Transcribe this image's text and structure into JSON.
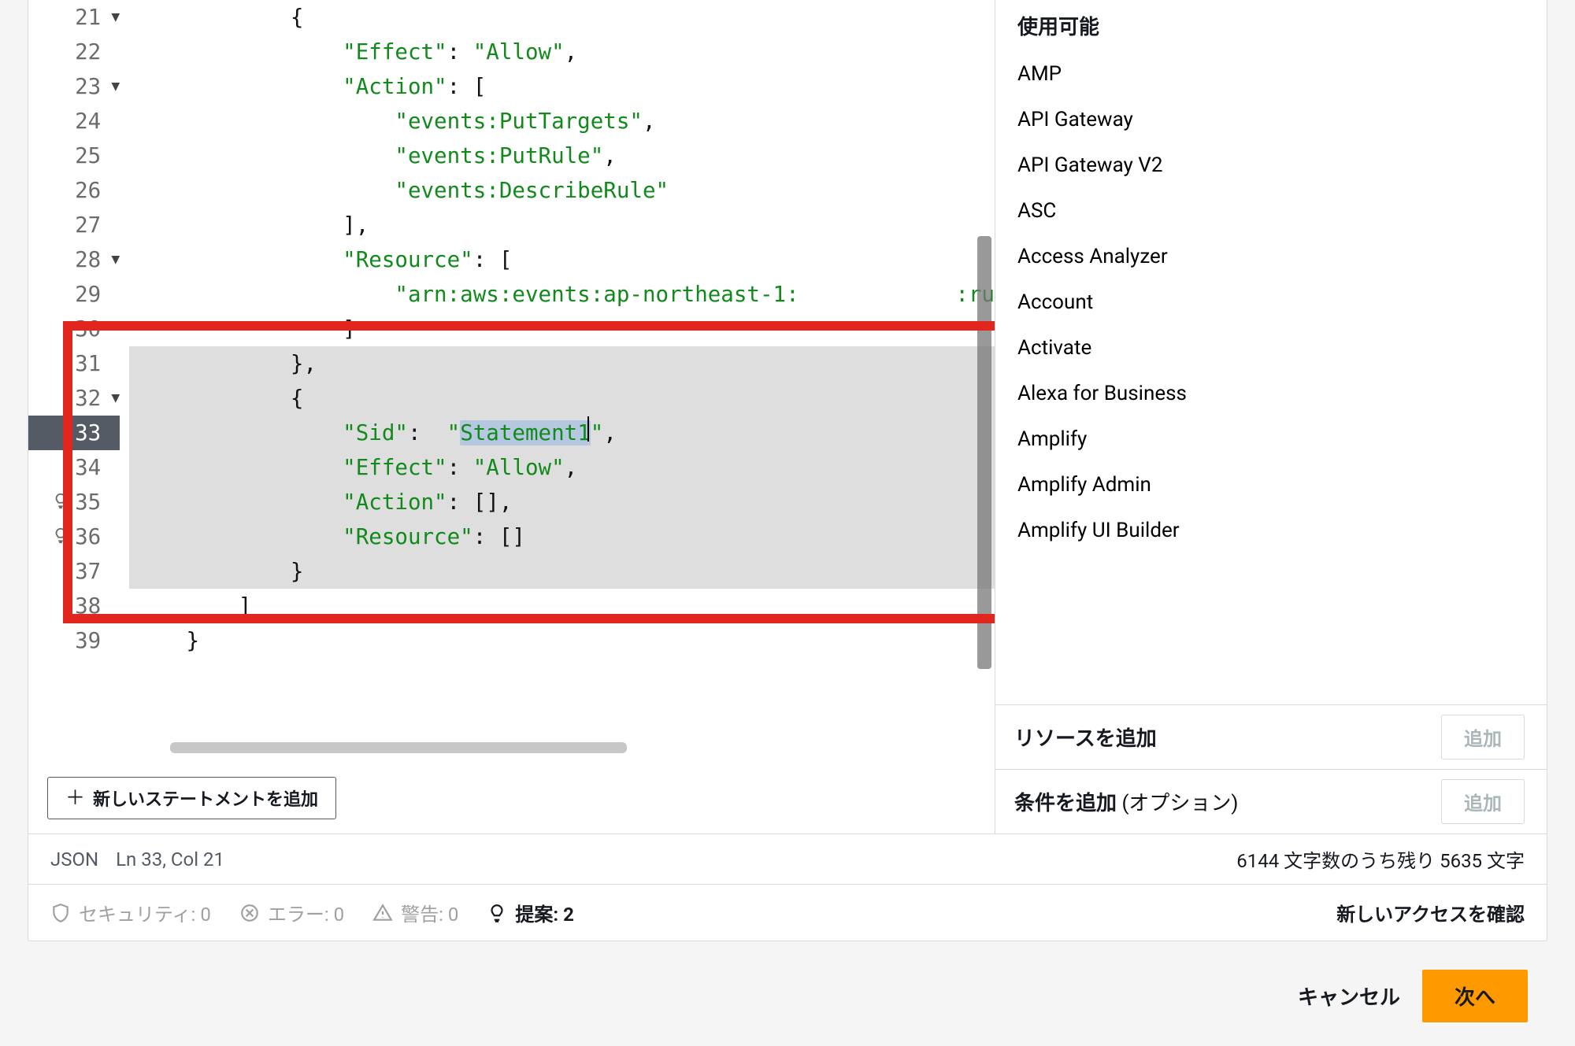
{
  "editor": {
    "lines": [
      {
        "num": 21,
        "fold": true,
        "segments": [
          {
            "t": "punc",
            "v": "            {"
          }
        ]
      },
      {
        "num": 22,
        "segments": [
          {
            "t": "punc",
            "v": "                "
          },
          {
            "t": "str",
            "v": "\"Effect\""
          },
          {
            "t": "punc",
            "v": ": "
          },
          {
            "t": "str",
            "v": "\"Allow\""
          },
          {
            "t": "punc",
            "v": ","
          }
        ]
      },
      {
        "num": 23,
        "fold": true,
        "segments": [
          {
            "t": "punc",
            "v": "                "
          },
          {
            "t": "str",
            "v": "\"Action\""
          },
          {
            "t": "punc",
            "v": ": ["
          }
        ]
      },
      {
        "num": 24,
        "segments": [
          {
            "t": "punc",
            "v": "                    "
          },
          {
            "t": "str",
            "v": "\"events:PutTargets\""
          },
          {
            "t": "punc",
            "v": ","
          }
        ]
      },
      {
        "num": 25,
        "segments": [
          {
            "t": "punc",
            "v": "                    "
          },
          {
            "t": "str",
            "v": "\"events:PutRule\""
          },
          {
            "t": "punc",
            "v": ","
          }
        ]
      },
      {
        "num": 26,
        "segments": [
          {
            "t": "punc",
            "v": "                    "
          },
          {
            "t": "str",
            "v": "\"events:DescribeRule\""
          }
        ]
      },
      {
        "num": 27,
        "segments": [
          {
            "t": "punc",
            "v": "                ],"
          }
        ]
      },
      {
        "num": 28,
        "fold": true,
        "segments": [
          {
            "t": "punc",
            "v": "                "
          },
          {
            "t": "str",
            "v": "\"Resource\""
          },
          {
            "t": "punc",
            "v": ": ["
          }
        ]
      },
      {
        "num": 29,
        "segments": [
          {
            "t": "punc",
            "v": "                    "
          },
          {
            "t": "str",
            "v": "\"arn:aws:events:ap-northeast-1:            :ru"
          }
        ]
      },
      {
        "num": 30,
        "segments": [
          {
            "t": "punc",
            "v": "                ]"
          }
        ]
      },
      {
        "num": 31,
        "sel": true,
        "segments": [
          {
            "t": "punc",
            "v": "            },"
          }
        ]
      },
      {
        "num": 32,
        "fold": true,
        "sel": true,
        "segments": [
          {
            "t": "punc",
            "v": "            {"
          }
        ]
      },
      {
        "num": 33,
        "current": true,
        "sel": true,
        "segments": [
          {
            "t": "punc",
            "v": "                "
          },
          {
            "t": "str",
            "v": "\"Sid\""
          },
          {
            "t": "punc",
            "v": ":  "
          },
          {
            "t": "str",
            "v": "\""
          },
          {
            "t": "str",
            "sel": true,
            "v": "Statement1"
          },
          {
            "t": "caret",
            "v": ""
          },
          {
            "t": "str",
            "v": "\""
          },
          {
            "t": "punc",
            "v": ","
          }
        ]
      },
      {
        "num": 34,
        "sel": true,
        "segments": [
          {
            "t": "punc",
            "v": "                "
          },
          {
            "t": "str",
            "v": "\"Effect\""
          },
          {
            "t": "punc",
            "v": ": "
          },
          {
            "t": "str",
            "v": "\"Allow\""
          },
          {
            "t": "punc",
            "v": ","
          }
        ]
      },
      {
        "num": 35,
        "bulb": true,
        "sel": true,
        "segments": [
          {
            "t": "punc",
            "v": "                "
          },
          {
            "t": "str",
            "v": "\"Action\""
          },
          {
            "t": "punc",
            "v": ": [],"
          }
        ]
      },
      {
        "num": 36,
        "bulb": true,
        "sel": true,
        "segments": [
          {
            "t": "punc",
            "v": "                "
          },
          {
            "t": "str",
            "v": "\"Resource\""
          },
          {
            "t": "punc",
            "v": ": []"
          }
        ]
      },
      {
        "num": 37,
        "sel": true,
        "segments": [
          {
            "t": "punc",
            "v": "            }"
          }
        ]
      },
      {
        "num": 38,
        "segments": [
          {
            "t": "punc",
            "v": "        ]"
          }
        ]
      },
      {
        "num": 39,
        "segments": [
          {
            "t": "punc",
            "v": "    }"
          }
        ]
      }
    ],
    "add_statement_label": "新しいステートメントを追加"
  },
  "sidebar": {
    "heading": "使用可能",
    "services": [
      "AMP",
      "API Gateway",
      "API Gateway V2",
      "ASC",
      "Access Analyzer",
      "Account",
      "Activate",
      "Alexa for Business",
      "Amplify",
      "Amplify Admin",
      "Amplify UI Builder"
    ],
    "add_resource_label": "リソースを追加",
    "add_condition_label": "条件を追加",
    "add_condition_optional": " (オプション)",
    "add_button": "追加"
  },
  "status": {
    "lang": "JSON",
    "pos": "Ln 33, Col 21",
    "chars": "6144 文字数のうち残り 5635 文字"
  },
  "issues": {
    "security": "セキュリティ: 0",
    "errors": "エラー: 0",
    "warnings": "警告: 0",
    "suggestions": "提案: 2",
    "review_access": "新しいアクセスを確認"
  },
  "footer": {
    "cancel": "キャンセル",
    "next": "次へ"
  }
}
